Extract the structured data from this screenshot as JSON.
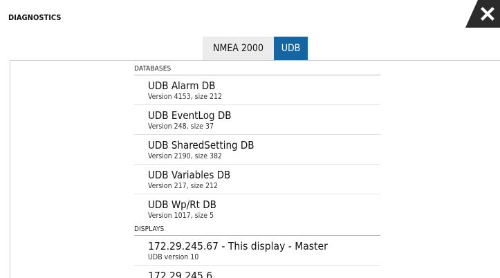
{
  "window": {
    "title": "DIAGNOSTICS",
    "close_icon": "close-icon"
  },
  "tabs": [
    {
      "label": "NMEA 2000",
      "selected": false
    },
    {
      "label": "UDB",
      "selected": true
    }
  ],
  "colors": {
    "accent": "#1565a3",
    "close_bg": "#2b2b2b",
    "tab_inactive_bg": "#ececec"
  },
  "databases": {
    "header": "DATABASES",
    "items": [
      {
        "name": "UDB Alarm DB",
        "detail": "Version  4153, size 212"
      },
      {
        "name": "UDB EventLog DB",
        "detail": "Version  248, size 37"
      },
      {
        "name": "UDB SharedSetting DB",
        "detail": "Version  2190, size 382"
      },
      {
        "name": "UDB Variables DB",
        "detail": "Version  217, size 212"
      },
      {
        "name": "UDB Wp/Rt DB",
        "detail": "Version  1017, size 5"
      }
    ]
  },
  "displays": {
    "header": "DISPLAYS",
    "items": [
      {
        "name": "172.29.245.67  -  This display  -  Master",
        "detail": "UDB version 10"
      },
      {
        "name": "172.29.245.6",
        "detail": ""
      }
    ]
  }
}
